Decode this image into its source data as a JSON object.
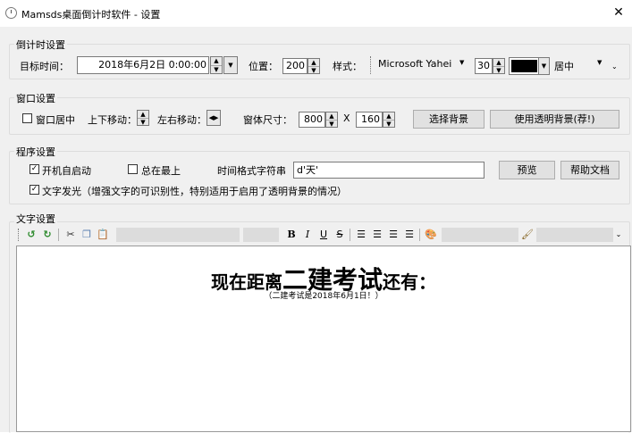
{
  "window": {
    "title": "Mamsds桌面倒计时软件 - 设置",
    "close": "✕"
  },
  "countdown_group": {
    "label": "倒计时设置",
    "target_label": "目标时间：",
    "target_value": "2018年6月2日 0:00:00",
    "position_label": "位置：",
    "position_value": "200",
    "style_label": "样式：",
    "font_value": "Microsoft Yahei",
    "size_value": "30",
    "color_value": "#000000",
    "align_value": "居中"
  },
  "window_group": {
    "label": "窗口设置",
    "center_label": "窗口居中",
    "updown_label": "上下移动：",
    "leftright_label": "左右移动：",
    "size_label": "窗体尺寸：",
    "width_value": "800",
    "x_label": "X",
    "height_value": "160",
    "choose_bg_label": "选择背景",
    "transparent_bg_label": "使用透明背景(荐!)"
  },
  "program_group": {
    "label": "程序设置",
    "autostart_label": "开机自启动",
    "autostart_checked": true,
    "topmost_label": "总在最上",
    "topmost_checked": false,
    "format_label": "时间格式字符串",
    "format_value": "d'天'",
    "preview_label": "预览",
    "help_label": "帮助文档",
    "glow_label": "文字发光（增强文字的可识别性，特别适用于启用了透明背景的情况）",
    "glow_checked": true
  },
  "text_group": {
    "label": "文字设置",
    "toolbar": {
      "bold": "B",
      "italic": "I",
      "underline": "U",
      "strike": "S"
    },
    "headline_pre": "现在距离",
    "headline_big": "二建考试",
    "headline_post": "还有：",
    "subline": "（二建考试是2018年6月1日！）"
  }
}
